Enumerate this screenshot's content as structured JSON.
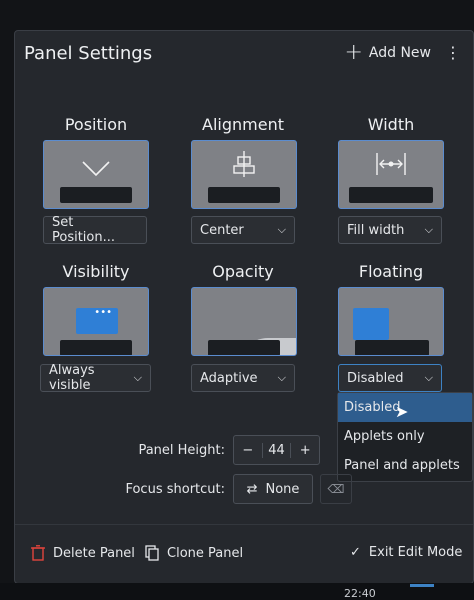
{
  "header": {
    "title": "Panel Settings",
    "add_new_label": "Add New"
  },
  "sections": {
    "position": {
      "label": "Position",
      "value": "Set Position..."
    },
    "alignment": {
      "label": "Alignment",
      "value": "Center"
    },
    "width": {
      "label": "Width",
      "value": "Fill width"
    },
    "visibility": {
      "label": "Visibility",
      "value": "Always visible"
    },
    "opacity": {
      "label": "Opacity",
      "value": "Adaptive"
    },
    "floating": {
      "label": "Floating",
      "value": "Disabled"
    }
  },
  "floating_menu": {
    "options": [
      "Disabled",
      "Applets only",
      "Panel and applets"
    ],
    "selected": "Disabled"
  },
  "panel_height": {
    "label": "Panel Height:",
    "value": "44"
  },
  "focus_shortcut": {
    "label": "Focus shortcut:",
    "value": "None"
  },
  "footer": {
    "delete": "Delete Panel",
    "clone": "Clone Panel",
    "exit": "Exit Edit Mode"
  },
  "taskbar": {
    "clock": "22:40"
  },
  "colors": {
    "accent": "#3d82c4",
    "delete_red": "#e0443c",
    "preview_blue": "#2f7fd6"
  }
}
